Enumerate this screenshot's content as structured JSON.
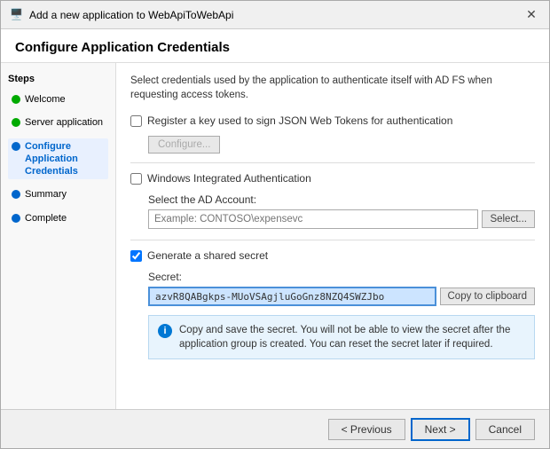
{
  "titleBar": {
    "icon": "⚙",
    "text": "Add a new application to WebApiToWebApi",
    "closeLabel": "✕"
  },
  "header": {
    "title": "Configure Application Credentials"
  },
  "steps": {
    "title": "Steps",
    "items": [
      {
        "id": "welcome",
        "label": "Welcome",
        "status": "green",
        "active": false
      },
      {
        "id": "server-application",
        "label": "Server application",
        "status": "green",
        "active": false
      },
      {
        "id": "configure-credentials",
        "label": "Configure Application\nCredentials",
        "status": "blue",
        "active": true
      },
      {
        "id": "summary",
        "label": "Summary",
        "status": "blue",
        "active": false
      },
      {
        "id": "complete",
        "label": "Complete",
        "status": "blue",
        "active": false
      }
    ]
  },
  "main": {
    "description": "Select credentials used by the application to authenticate itself with AD FS when requesting access tokens.",
    "option1": {
      "label": "Register a key used to sign JSON Web Tokens for authentication",
      "checked": false,
      "configureButton": "Configure..."
    },
    "option2": {
      "label": "Windows Integrated Authentication",
      "checked": false,
      "subLabel": "Select the AD Account:",
      "placeholder": "Example: CONTOSO\\expensevc",
      "selectButton": "Select..."
    },
    "option3": {
      "label": "Generate a shared secret",
      "checked": true,
      "secretLabel": "Secret:",
      "secretValue": "azvR8QABgkps-MUoVSAgjluGoGnz8NZQ4SWZJbo",
      "copyButton": "Copy to clipboard"
    },
    "infoBox": {
      "text": "Copy and save the secret.  You will not be able to view the secret after the application group is created.  You can reset the secret later if required."
    }
  },
  "footer": {
    "previousButton": "< Previous",
    "nextButton": "Next >",
    "cancelButton": "Cancel"
  }
}
